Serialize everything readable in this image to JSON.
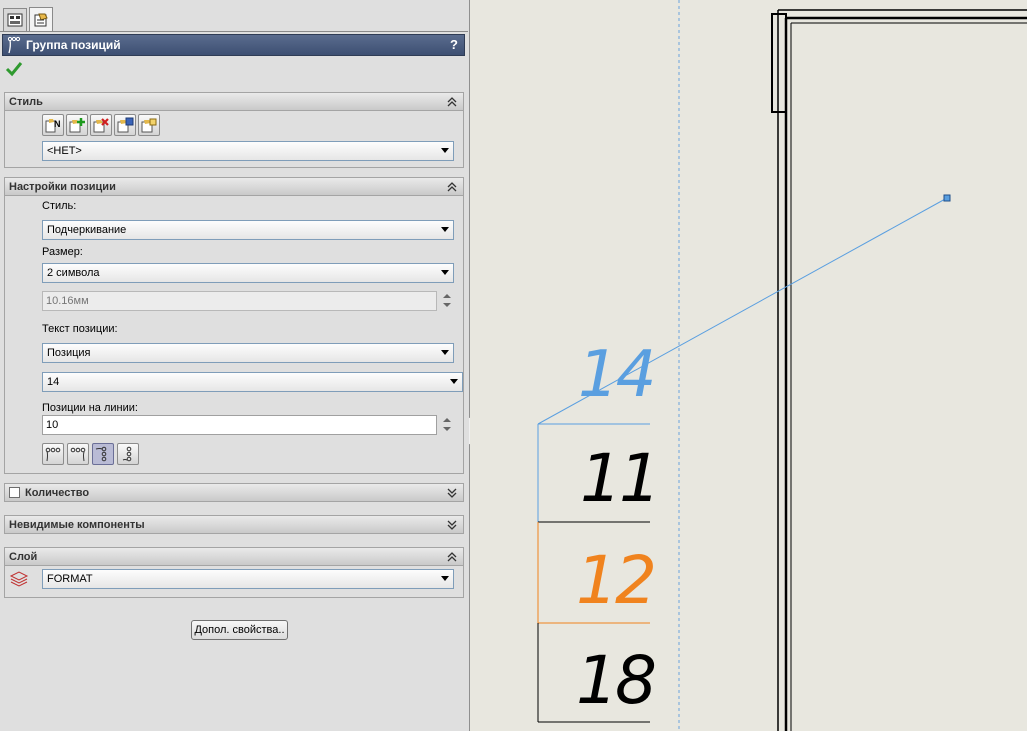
{
  "panel": {
    "title": "Группа позиций",
    "help": "?",
    "sections": {
      "style": {
        "header": "Стиль",
        "combo_value": "<НЕТ>"
      },
      "balloon_settings": {
        "header": "Настройки позиции",
        "style_label": "Стиль:",
        "style_value": "Подчеркивание",
        "size_label": "Размер:",
        "size_value": "2 символа",
        "size_mm": "10.16мм",
        "text_label": "Текст позиции:",
        "text_value": "Позиция",
        "number_value": "14",
        "per_line_label": "Позиции на линии:",
        "per_line_value": "10"
      },
      "quantity": {
        "header": "Количество"
      },
      "hidden_components": {
        "header": "Невидимые компоненты"
      },
      "layer": {
        "header": "Слой",
        "value": "FORMAT"
      }
    },
    "more_props_button": "Допол. свойства.."
  },
  "canvas": {
    "balloons": [
      {
        "number": "14",
        "state": "preview",
        "color": "#5a9fe0"
      },
      {
        "number": "11",
        "state": "normal",
        "color": "#000000"
      },
      {
        "number": "12",
        "state": "highlighted",
        "color": "#f0831e"
      },
      {
        "number": "18",
        "state": "normal",
        "color": "#000000"
      }
    ]
  },
  "colors": {
    "titlebar": "#4a5c80",
    "canvas_bg": "#e8e7df",
    "preview_blue": "#5a9fe0",
    "highlight_orange": "#f0831e"
  }
}
